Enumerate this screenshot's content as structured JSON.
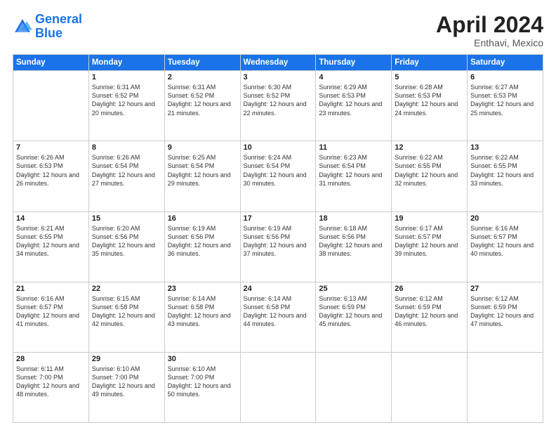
{
  "header": {
    "logo_line1": "General",
    "logo_line2": "Blue",
    "month": "April 2024",
    "location": "Enthavi, Mexico"
  },
  "days_header": [
    "Sunday",
    "Monday",
    "Tuesday",
    "Wednesday",
    "Thursday",
    "Friday",
    "Saturday"
  ],
  "weeks": [
    [
      {
        "day": "",
        "sunrise": "",
        "sunset": "",
        "daylight": ""
      },
      {
        "day": "1",
        "sunrise": "Sunrise: 6:31 AM",
        "sunset": "Sunset: 6:52 PM",
        "daylight": "Daylight: 12 hours and 20 minutes."
      },
      {
        "day": "2",
        "sunrise": "Sunrise: 6:31 AM",
        "sunset": "Sunset: 6:52 PM",
        "daylight": "Daylight: 12 hours and 21 minutes."
      },
      {
        "day": "3",
        "sunrise": "Sunrise: 6:30 AM",
        "sunset": "Sunset: 6:52 PM",
        "daylight": "Daylight: 12 hours and 22 minutes."
      },
      {
        "day": "4",
        "sunrise": "Sunrise: 6:29 AM",
        "sunset": "Sunset: 6:53 PM",
        "daylight": "Daylight: 12 hours and 23 minutes."
      },
      {
        "day": "5",
        "sunrise": "Sunrise: 6:28 AM",
        "sunset": "Sunset: 6:53 PM",
        "daylight": "Daylight: 12 hours and 24 minutes."
      },
      {
        "day": "6",
        "sunrise": "Sunrise: 6:27 AM",
        "sunset": "Sunset: 6:53 PM",
        "daylight": "Daylight: 12 hours and 25 minutes."
      }
    ],
    [
      {
        "day": "7",
        "sunrise": "Sunrise: 6:26 AM",
        "sunset": "Sunset: 6:53 PM",
        "daylight": "Daylight: 12 hours and 26 minutes."
      },
      {
        "day": "8",
        "sunrise": "Sunrise: 6:26 AM",
        "sunset": "Sunset: 6:54 PM",
        "daylight": "Daylight: 12 hours and 27 minutes."
      },
      {
        "day": "9",
        "sunrise": "Sunrise: 6:25 AM",
        "sunset": "Sunset: 6:54 PM",
        "daylight": "Daylight: 12 hours and 29 minutes."
      },
      {
        "day": "10",
        "sunrise": "Sunrise: 6:24 AM",
        "sunset": "Sunset: 6:54 PM",
        "daylight": "Daylight: 12 hours and 30 minutes."
      },
      {
        "day": "11",
        "sunrise": "Sunrise: 6:23 AM",
        "sunset": "Sunset: 6:54 PM",
        "daylight": "Daylight: 12 hours and 31 minutes."
      },
      {
        "day": "12",
        "sunrise": "Sunrise: 6:22 AM",
        "sunset": "Sunset: 6:55 PM",
        "daylight": "Daylight: 12 hours and 32 minutes."
      },
      {
        "day": "13",
        "sunrise": "Sunrise: 6:22 AM",
        "sunset": "Sunset: 6:55 PM",
        "daylight": "Daylight: 12 hours and 33 minutes."
      }
    ],
    [
      {
        "day": "14",
        "sunrise": "Sunrise: 6:21 AM",
        "sunset": "Sunset: 6:55 PM",
        "daylight": "Daylight: 12 hours and 34 minutes."
      },
      {
        "day": "15",
        "sunrise": "Sunrise: 6:20 AM",
        "sunset": "Sunset: 6:56 PM",
        "daylight": "Daylight: 12 hours and 35 minutes."
      },
      {
        "day": "16",
        "sunrise": "Sunrise: 6:19 AM",
        "sunset": "Sunset: 6:56 PM",
        "daylight": "Daylight: 12 hours and 36 minutes."
      },
      {
        "day": "17",
        "sunrise": "Sunrise: 6:19 AM",
        "sunset": "Sunset: 6:56 PM",
        "daylight": "Daylight: 12 hours and 37 minutes."
      },
      {
        "day": "18",
        "sunrise": "Sunrise: 6:18 AM",
        "sunset": "Sunset: 6:56 PM",
        "daylight": "Daylight: 12 hours and 38 minutes."
      },
      {
        "day": "19",
        "sunrise": "Sunrise: 6:17 AM",
        "sunset": "Sunset: 6:57 PM",
        "daylight": "Daylight: 12 hours and 39 minutes."
      },
      {
        "day": "20",
        "sunrise": "Sunrise: 6:16 AM",
        "sunset": "Sunset: 6:57 PM",
        "daylight": "Daylight: 12 hours and 40 minutes."
      }
    ],
    [
      {
        "day": "21",
        "sunrise": "Sunrise: 6:16 AM",
        "sunset": "Sunset: 6:57 PM",
        "daylight": "Daylight: 12 hours and 41 minutes."
      },
      {
        "day": "22",
        "sunrise": "Sunrise: 6:15 AM",
        "sunset": "Sunset: 6:58 PM",
        "daylight": "Daylight: 12 hours and 42 minutes."
      },
      {
        "day": "23",
        "sunrise": "Sunrise: 6:14 AM",
        "sunset": "Sunset: 6:58 PM",
        "daylight": "Daylight: 12 hours and 43 minutes."
      },
      {
        "day": "24",
        "sunrise": "Sunrise: 6:14 AM",
        "sunset": "Sunset: 6:58 PM",
        "daylight": "Daylight: 12 hours and 44 minutes."
      },
      {
        "day": "25",
        "sunrise": "Sunrise: 6:13 AM",
        "sunset": "Sunset: 6:59 PM",
        "daylight": "Daylight: 12 hours and 45 minutes."
      },
      {
        "day": "26",
        "sunrise": "Sunrise: 6:12 AM",
        "sunset": "Sunset: 6:59 PM",
        "daylight": "Daylight: 12 hours and 46 minutes."
      },
      {
        "day": "27",
        "sunrise": "Sunrise: 6:12 AM",
        "sunset": "Sunset: 6:59 PM",
        "daylight": "Daylight: 12 hours and 47 minutes."
      }
    ],
    [
      {
        "day": "28",
        "sunrise": "Sunrise: 6:11 AM",
        "sunset": "Sunset: 7:00 PM",
        "daylight": "Daylight: 12 hours and 48 minutes."
      },
      {
        "day": "29",
        "sunrise": "Sunrise: 6:10 AM",
        "sunset": "Sunset: 7:00 PM",
        "daylight": "Daylight: 12 hours and 49 minutes."
      },
      {
        "day": "30",
        "sunrise": "Sunrise: 6:10 AM",
        "sunset": "Sunset: 7:00 PM",
        "daylight": "Daylight: 12 hours and 50 minutes."
      },
      {
        "day": "",
        "sunrise": "",
        "sunset": "",
        "daylight": ""
      },
      {
        "day": "",
        "sunrise": "",
        "sunset": "",
        "daylight": ""
      },
      {
        "day": "",
        "sunrise": "",
        "sunset": "",
        "daylight": ""
      },
      {
        "day": "",
        "sunrise": "",
        "sunset": "",
        "daylight": ""
      }
    ]
  ]
}
